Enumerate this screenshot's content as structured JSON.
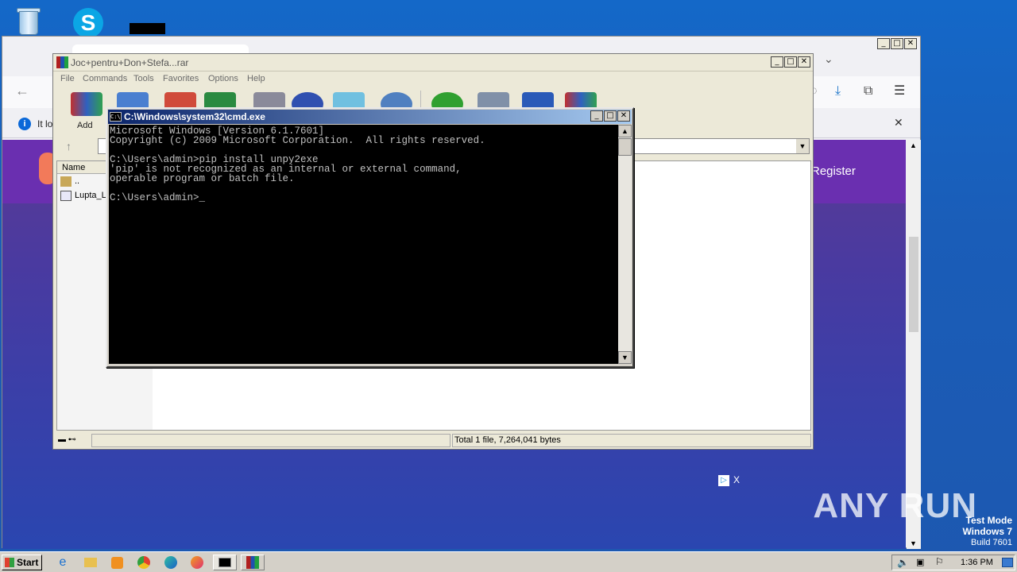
{
  "colors": {
    "desktop_blue": "#1468c8",
    "cmd_title_start": "#0a246a",
    "cmd_title_end": "#a6caf0",
    "console_bg": "#000000",
    "console_fg": "#c0c0c0",
    "browser_purple": "#6a2fb0"
  },
  "browser": {
    "info_text": "It lo",
    "register_label": "Register"
  },
  "winrar": {
    "title": "Joc+pentru+Don+Stefa...rar",
    "menu": [
      "File",
      "Commands",
      "Tools",
      "Favorites",
      "Options",
      "Help"
    ],
    "add_label": "Add",
    "columns": {
      "name": "Name"
    },
    "files": [
      "..",
      "Lupta_L"
    ],
    "status": "Total 1 file, 7,264,041 bytes"
  },
  "cmd": {
    "title": "C:\\Windows\\system32\\cmd.exe",
    "console_text": "Microsoft Windows [Version 6.1.7601]\nCopyright (c) 2009 Microsoft Corporation.  All rights reserved.\n\nC:\\Users\\admin>pip install unpy2exe\n'pip' is not recognized as an internal or external command,\noperable program or batch file.\n\nC:\\Users\\admin>_"
  },
  "ad": {
    "close_label": "X"
  },
  "taskbar": {
    "start_label": "Start",
    "clock": "1:36 PM",
    "apps": [
      "internet-explorer-icon",
      "folder-icon",
      "media-player-icon",
      "chrome-icon",
      "edge-icon",
      "firefox-icon",
      "cmd-icon",
      "winrar-icon"
    ]
  },
  "watermark": {
    "text": "ANY RUN"
  },
  "os_notice": {
    "line1": "Test Mode",
    "line2": "Windows 7",
    "line3": "Build 7601"
  }
}
